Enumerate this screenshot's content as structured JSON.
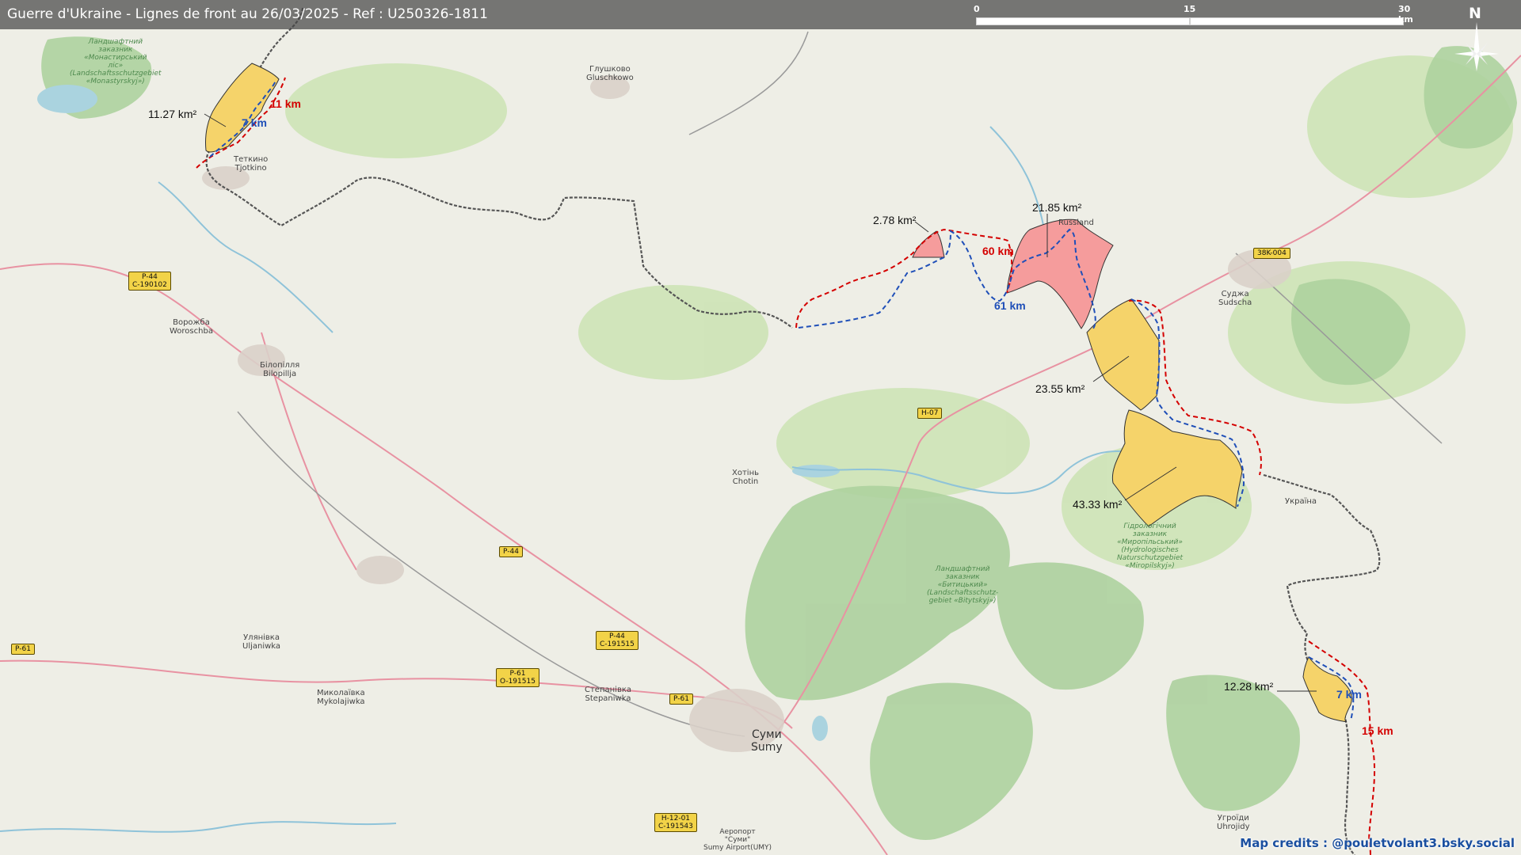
{
  "title": "Guerre d'Ukraine - Lignes de front au 26/03/2025 - Ref : U250326-1811",
  "scale_bar": {
    "ticks": [
      "0",
      "15",
      "30 km"
    ]
  },
  "north_arrow": {
    "label": "N",
    "icon": "compass-rose-icon"
  },
  "credits": "Map credits : @pouletvolant3.bsky.social",
  "colors": {
    "ukraine_gain": "#f5d36a",
    "russia_gain": "#f59c9c",
    "line_red": "#d40000",
    "line_blue": "#1f4fb8",
    "border": "#555555",
    "forest": "#add19e",
    "road_primary": "#e892a2"
  },
  "places": {
    "tetkino": "Теткино\nTjotkino",
    "glushkovo": "Глушково\nGluschkowo",
    "vorozhba": "Ворожба\nWoroschba",
    "bilopillia": "Білопілля\nBilopillja",
    "sudzha": "Суджа\nSudscha",
    "khotin": "Хотінь\nChotin",
    "ulianivka": "Улянівка\nUljaniwka",
    "mykolaivka": "Миколаївка\nMykolajiwka",
    "stepanivka": "Степанівка\nStepaniwka",
    "sumy": "Суми\nSumy",
    "uhroidy": "Угроїди\nUhrojidy",
    "airport": "Аеропорт\n\"Суми\"\nSumy Airport(UMY)",
    "rossiia": "Russland",
    "ukraina": "Україна",
    "reserve_north": "Ландшафтний\nзаказник\n«Монастирський\nліс»\n(Landschaftsschutzgebiet\n«Monastyrskyj»)",
    "reserve_miropilskyi": "Гідрологічний\nзаказник\n«Миропільський»\n(Hydrologisches\nNaturschutzgebiet\n«Miropilskyj»)",
    "reserve_vilnyi": "Ландшафтний\nзаказник\n«Битицький»\n(Landschaftsschutz-\ngebiet «Bitytskyj»)"
  },
  "roads": {
    "p44_c190102": "P-44\nC-190102",
    "h07": "H-07",
    "r38k004": "38K-004",
    "p44": "P-44",
    "p61_left": "P-61",
    "p44_c191515": "P-44\nC-191515",
    "p61_o191515": "P-61\nO-191515",
    "p61": "P-61",
    "h1201": "H-12-01\nC-191543"
  },
  "annotations": {
    "area_1": "11.27 km²",
    "area_2": "2.78 km²",
    "area_3": "21.85 km²",
    "area_4": "23.55 km²",
    "area_5": "43.33 km²",
    "area_6": "12.28 km²",
    "dist_red_1": "11 km",
    "dist_blue_1": "7 km",
    "dist_red_2": "60 km",
    "dist_blue_2": "61 km",
    "dist_blue_3": "7 km",
    "dist_red_3": "15 km"
  }
}
